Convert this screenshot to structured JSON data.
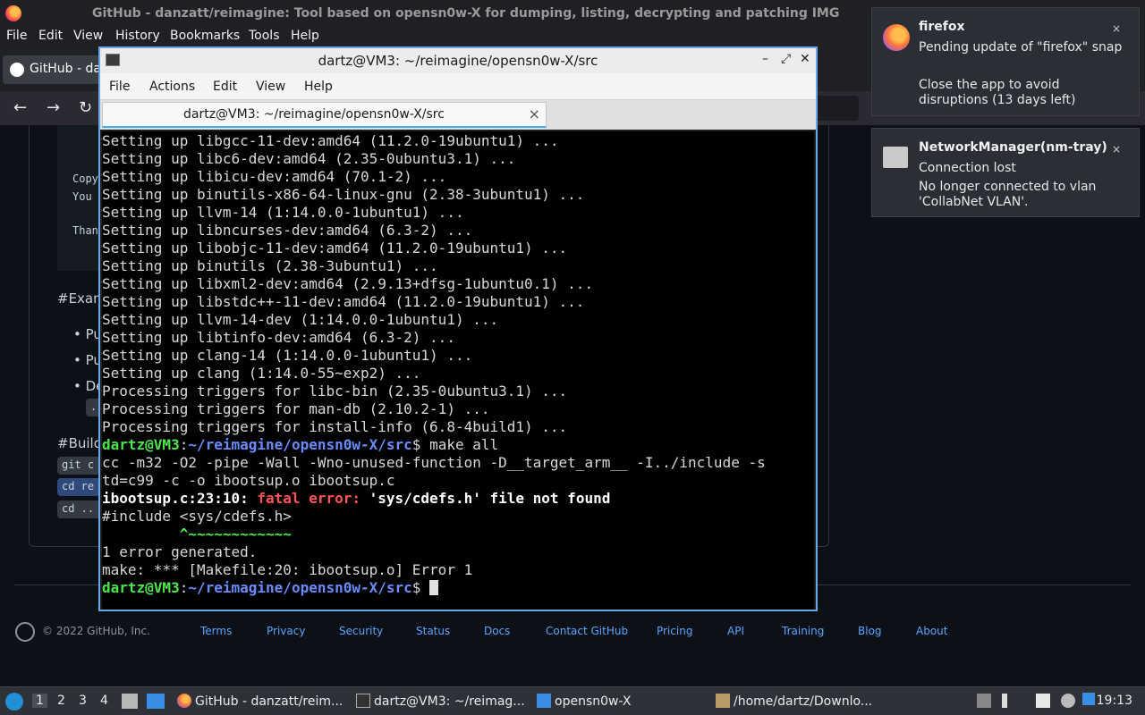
{
  "firefox": {
    "window_title": "GitHub - danzatt/reimagine: Tool based on opensn0w-X for dumping, listing, decrypting and patching IMG",
    "menu": [
      "File",
      "Edit",
      "View",
      "History",
      "Bookmarks",
      "Tools",
      "Help"
    ],
    "tab_label": "GitHub - dan",
    "nav": {
      "back": "←",
      "forward": "→",
      "reload": "↻"
    }
  },
  "github_page": {
    "code_lines": [
      "Copy",
      "You",
      "Than"
    ],
    "heading_examples": "#Exam",
    "bullets": [
      "Pu",
      "Pu",
      "De"
    ],
    "dots": "..",
    "heading_build": "#Build",
    "code_pills": [
      "git c",
      "cd re",
      "cd .."
    ],
    "copyright": "© 2022 GitHub, Inc.",
    "footer_links": [
      "Terms",
      "Privacy",
      "Security",
      "Status",
      "Docs",
      "Contact GitHub",
      "Pricing",
      "API",
      "Training",
      "Blog",
      "About"
    ]
  },
  "terminal": {
    "title": "dartz@VM3: ~/reimagine/opensn0w-X/src",
    "menu": [
      "File",
      "Actions",
      "Edit",
      "View",
      "Help"
    ],
    "tab_label": "dartz@VM3: ~/reimagine/opensn0w-X/src",
    "tab_close": "×",
    "controls": {
      "minimize": "–",
      "maximize": "⤢",
      "close": "✕"
    },
    "setup_lines": [
      "Setting up libgcc-11-dev:amd64 (11.2.0-19ubuntu1) ...",
      "Setting up libc6-dev:amd64 (2.35-0ubuntu3.1) ...",
      "Setting up libicu-dev:amd64 (70.1-2) ...",
      "Setting up binutils-x86-64-linux-gnu (2.38-3ubuntu1) ...",
      "Setting up llvm-14 (1:14.0.0-1ubuntu1) ...",
      "Setting up libncurses-dev:amd64 (6.3-2) ...",
      "Setting up libobjc-11-dev:amd64 (11.2.0-19ubuntu1) ...",
      "Setting up binutils (2.38-3ubuntu1) ...",
      "Setting up libxml2-dev:amd64 (2.9.13+dfsg-1ubuntu0.1) ...",
      "Setting up libstdc++-11-dev:amd64 (11.2.0-19ubuntu1) ...",
      "Setting up llvm-14-dev (1:14.0.0-1ubuntu1) ...",
      "Setting up libtinfo-dev:amd64 (6.3-2) ...",
      "Setting up clang-14 (1:14.0.0-1ubuntu1) ...",
      "Setting up clang (1:14.0-55~exp2) ...",
      "Processing triggers for libc-bin (2.35-0ubuntu3.1) ...",
      "Processing triggers for man-db (2.10.2-1) ...",
      "Processing triggers for install-info (6.8-4build1) ..."
    ],
    "prompt_user": "dartz@VM3",
    "prompt_path": "~/reimagine/opensn0w-X/src",
    "prompt_sep": ":",
    "prompt_dollar": "$",
    "command": " make all",
    "cc_line1": "cc -m32 -O2 -pipe -Wall -Wno-unused-function -D__target_arm__ -I../include -s",
    "cc_line2": "td=c99 -c -o ibootsup.o ibootsup.c",
    "err_loc": "ibootsup.c:23:10: ",
    "err_label": "fatal error: ",
    "err_msg": "'sys/cdefs.h' file not found",
    "include_line": "#include <sys/cdefs.h>",
    "caret_line": "         ^~~~~~~~~~~~~",
    "generated": "1 error generated.",
    "make_err": "make: *** [Makefile:20: ibootsup.o] Error 1"
  },
  "notifications": [
    {
      "app": "firefox",
      "summary": "Pending update of \"firefox\" snap",
      "body": "Close the app to avoid disruptions (13 days left)",
      "close": "×"
    },
    {
      "app": "NetworkManager(nm-tray)",
      "summary": "Connection lost",
      "body": "No longer connected to vlan 'CollabNet VLAN'.",
      "close": "×"
    }
  ],
  "taskbar": {
    "workspaces": [
      "1",
      "2",
      "3",
      "4"
    ],
    "tasks": [
      "GitHub - danzatt/reim...",
      "dartz@VM3: ~/reimag...",
      "opensn0w-X",
      "/home/dartz/Downlo..."
    ],
    "clock": "19:13"
  }
}
